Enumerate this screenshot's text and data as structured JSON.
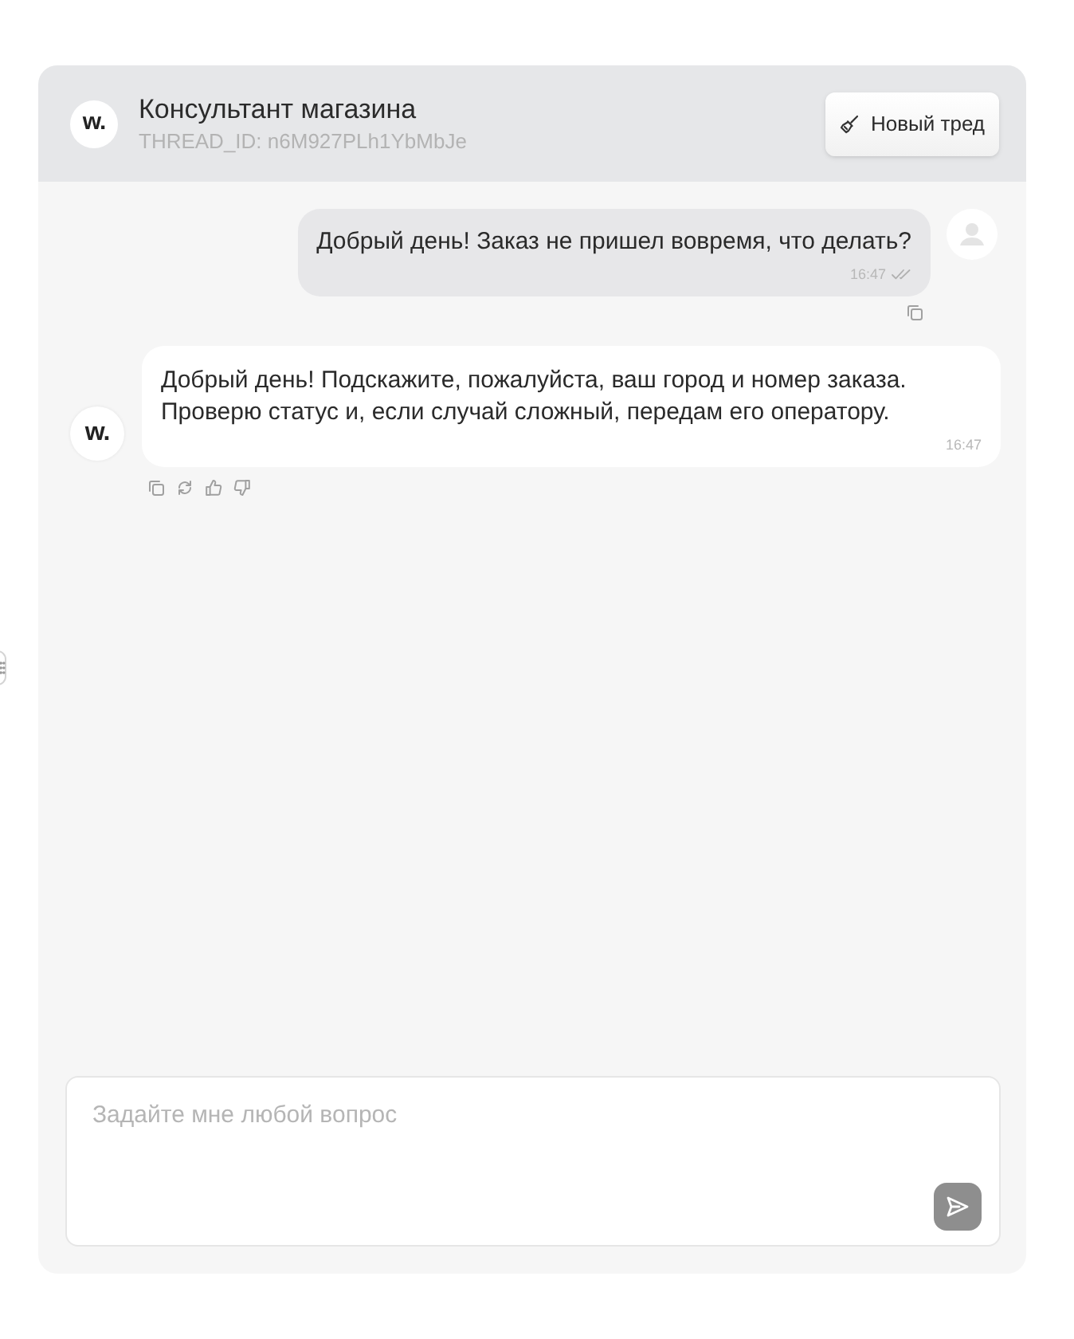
{
  "header": {
    "logo": "w.",
    "title": "Консультант магазина",
    "thread_id": "THREAD_ID: n6M927PLh1YbMbJe",
    "new_thread_button": "Новый тред"
  },
  "messages": [
    {
      "kind": "user",
      "text": "Добрый день! Заказ не пришел вовремя, что делать?",
      "time": "16:47",
      "read": true
    },
    {
      "kind": "assistant",
      "avatar": "w.",
      "text": "Добрый день! Подскажите, пожалуйста, ваш город и номер заказа. Проверю статус и, если случай сложный, передам его оператору.",
      "time": "16:47"
    }
  ],
  "composer": {
    "placeholder": "Задайте мне любой вопрос",
    "send_disabled": true
  }
}
